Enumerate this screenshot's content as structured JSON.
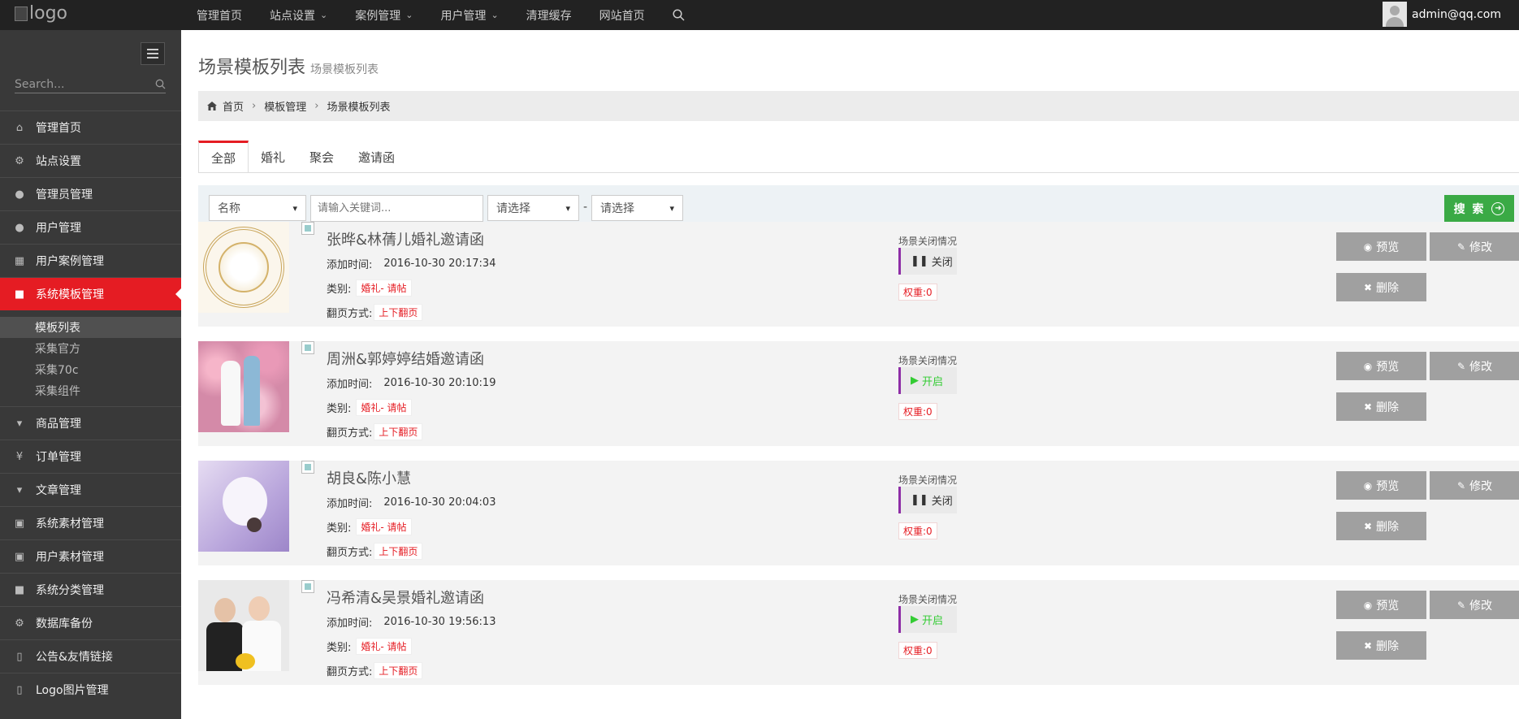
{
  "logo": {
    "alt": "logo"
  },
  "topnav": [
    {
      "label": "管理首页",
      "caret": false
    },
    {
      "label": "站点设置",
      "caret": true
    },
    {
      "label": "案例管理",
      "caret": true
    },
    {
      "label": "用户管理",
      "caret": true
    },
    {
      "label": "清理缓存",
      "caret": false
    },
    {
      "label": "网站首页",
      "caret": false
    }
  ],
  "user": {
    "email": "admin@qq.com"
  },
  "sidebar": {
    "search_placeholder": "Search...",
    "items": [
      {
        "label": "管理首页",
        "icon": "home-icon",
        "glyph": "⌂"
      },
      {
        "label": "站点设置",
        "icon": "gears-icon",
        "glyph": "⚙"
      },
      {
        "label": "管理员管理",
        "icon": "user-icon",
        "glyph": "●"
      },
      {
        "label": "用户管理",
        "icon": "user-icon",
        "glyph": "●"
      },
      {
        "label": "用户案例管理",
        "icon": "table-icon",
        "glyph": "▦"
      },
      {
        "label": "系统模板管理",
        "icon": "briefcase-icon",
        "glyph": "■",
        "active": true
      }
    ],
    "sub_items": [
      {
        "label": "模板列表",
        "current": true
      },
      {
        "label": "采集官方"
      },
      {
        "label": "采集70c"
      },
      {
        "label": "采集组件"
      }
    ],
    "items2": [
      {
        "label": "商品管理",
        "icon": "caret-square-icon",
        "glyph": "▾"
      },
      {
        "label": "订单管理",
        "icon": "yen-icon",
        "glyph": "¥"
      },
      {
        "label": "文章管理",
        "icon": "caret-square-icon",
        "glyph": "▾"
      },
      {
        "label": "系统素材管理",
        "icon": "gift-icon",
        "glyph": "▣"
      },
      {
        "label": "用户素材管理",
        "icon": "gift-icon",
        "glyph": "▣"
      },
      {
        "label": "系统分类管理",
        "icon": "briefcase-icon",
        "glyph": "■"
      },
      {
        "label": "数据库备份",
        "icon": "gears-icon",
        "glyph": "⚙"
      },
      {
        "label": "公告&友情链接",
        "icon": "bookmark-icon",
        "glyph": "▯"
      },
      {
        "label": "Logo图片管理",
        "icon": "bookmark-icon",
        "glyph": "▯"
      }
    ]
  },
  "page": {
    "title": "场景模板列表",
    "subtitle": "场景模板列表"
  },
  "breadcrumb": [
    "首页",
    "模板管理",
    "场景模板列表"
  ],
  "tabs": [
    "全部",
    "婚礼",
    "聚会",
    "邀请函"
  ],
  "filter": {
    "field_select": "名称",
    "keyword_placeholder": "请输入关键词...",
    "select_a": "请选择",
    "dash": "-",
    "select_b": "请选择",
    "search_label": "搜 索"
  },
  "labels": {
    "add_time": "添加时间:",
    "category": "类别:",
    "paging": "翻页方式:",
    "status_title": "场景关闭情况",
    "preview": "预览",
    "edit": "修改",
    "delete": "删除"
  },
  "cards": [
    {
      "title": "张晔&林蒨儿婚礼邀请函",
      "time": "2016-10-30 20:17:34",
      "category": "婚礼- 请帖",
      "paging": "上下翻页",
      "status": "关闭",
      "status_open": false,
      "weight": "权重:0",
      "thumb": "emblem"
    },
    {
      "title": "周洲&郭婷婷结婚邀请函",
      "time": "2016-10-30 20:10:19",
      "category": "婚礼- 请帖",
      "paging": "上下翻页",
      "status": "开启",
      "status_open": true,
      "weight": "权重:0",
      "thumb": "flowers"
    },
    {
      "title": "胡良&陈小慧",
      "time": "2016-10-30 20:04:03",
      "category": "婚礼- 请帖",
      "paging": "上下翻页",
      "status": "关闭",
      "status_open": false,
      "weight": "权重:0",
      "thumb": "lavender"
    },
    {
      "title": "冯希清&吴景婚礼邀请函",
      "time": "2016-10-30 19:56:13",
      "category": "婚礼- 请帖",
      "paging": "上下翻页",
      "status": "开启",
      "status_open": true,
      "weight": "权重:0",
      "thumb": "couple"
    }
  ]
}
